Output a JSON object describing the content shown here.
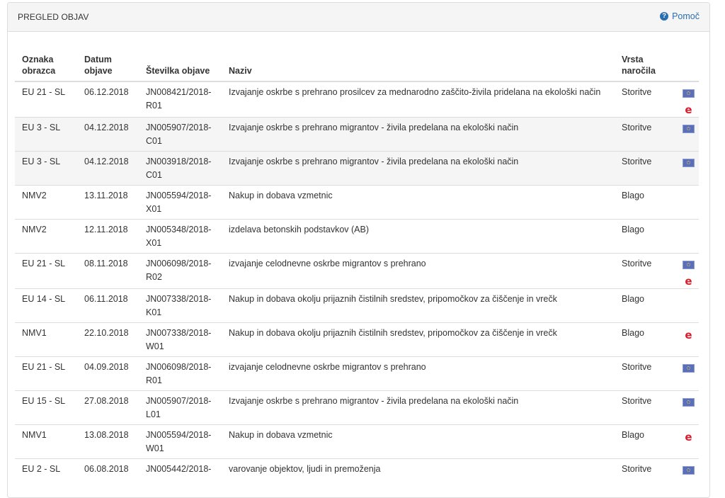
{
  "panel": {
    "title": "PREGLED OBJAV",
    "help_label": "Pomoč"
  },
  "table": {
    "headers": {
      "oznaka_1": "Oznaka",
      "oznaka_2": "obrazca",
      "datum_1": "Datum",
      "datum_2": "objave",
      "stevilka": "Številka objave",
      "naziv": "Naziv",
      "vrsta_1": "Vrsta",
      "vrsta_2": "naročila"
    },
    "rows": [
      {
        "oznaka": "EU 21 - SL",
        "datum": "06.12.2018",
        "stevilka_1": "JN008421/2018-",
        "stevilka_2": "R01",
        "naziv": "Izvajanje oskrbe s prehrano prosilcev za mednarodno zaščito-živila pridelana na ekološki način",
        "vrsta": "Storitve",
        "eu": true,
        "e": true
      },
      {
        "oznaka": "EU 3 - SL",
        "datum": "04.12.2018",
        "stevilka_1": "JN005907/2018-",
        "stevilka_2": "C01",
        "naziv": "Izvajanje oskrbe s prehrano migrantov - živila predelana na ekološki način",
        "vrsta": "Storitve",
        "eu": true,
        "e": false
      },
      {
        "oznaka": "EU 3 - SL",
        "datum": "04.12.2018",
        "stevilka_1": "JN003918/2018-",
        "stevilka_2": "C01",
        "naziv": "Izvajanje oskrbe s prehrano migrantov - živila predelana na ekološki način",
        "vrsta": "Storitve",
        "eu": true,
        "e": false
      },
      {
        "oznaka": "NMV2",
        "datum": "13.11.2018",
        "stevilka_1": "JN005594/2018-",
        "stevilka_2": "X01",
        "naziv": "Nakup in dobava vzmetnic",
        "vrsta": "Blago",
        "eu": false,
        "e": false
      },
      {
        "oznaka": "NMV2",
        "datum": "12.11.2018",
        "stevilka_1": "JN005348/2018-",
        "stevilka_2": "X01",
        "naziv": "izdelava betonskih podstavkov (AB)",
        "vrsta": "Blago",
        "eu": false,
        "e": false
      },
      {
        "oznaka": "EU 21 - SL",
        "datum": "08.11.2018",
        "stevilka_1": "JN006098/2018-",
        "stevilka_2": "R02",
        "naziv": "izvajanje celodnevne oskrbe migrantov s prehrano",
        "vrsta": "Storitve",
        "eu": true,
        "e": true
      },
      {
        "oznaka": "EU 14 - SL",
        "datum": "06.11.2018",
        "stevilka_1": "JN007338/2018-",
        "stevilka_2": "K01",
        "naziv": "Nakup in dobava okolju prijaznih čistilnih sredstev, pripomočkov za čiščenje in vrečk",
        "vrsta": "Blago",
        "eu": false,
        "e": false
      },
      {
        "oznaka": "NMV1",
        "datum": "22.10.2018",
        "stevilka_1": "JN007338/2018-",
        "stevilka_2": "W01",
        "naziv": "Nakup in dobava okolju prijaznih čistilnih sredstev, pripomočkov za čiščenje in vrečk",
        "vrsta": "Blago",
        "eu": false,
        "e": true
      },
      {
        "oznaka": "EU 21 - SL",
        "datum": "04.09.2018",
        "stevilka_1": "JN006098/2018-",
        "stevilka_2": "R01",
        "naziv": "izvajanje celodnevne oskrbe migrantov s prehrano",
        "vrsta": "Storitve",
        "eu": true,
        "e": false
      },
      {
        "oznaka": "EU 15 - SL",
        "datum": "27.08.2018",
        "stevilka_1": "JN005907/2018-",
        "stevilka_2": "L01",
        "naziv": "Izvajanje oskrbe s prehrano migrantov - živila predelana na ekološki način",
        "vrsta": "Storitve",
        "eu": true,
        "e": false
      },
      {
        "oznaka": "NMV1",
        "datum": "13.08.2018",
        "stevilka_1": "JN005594/2018-",
        "stevilka_2": "W01",
        "naziv": "Nakup in dobava vzmetnic",
        "vrsta": "Blago",
        "eu": false,
        "e": true
      },
      {
        "oznaka": "EU 2 - SL",
        "datum": "06.08.2018",
        "stevilka_1": "JN005442/2018-",
        "stevilka_2": "",
        "naziv": "varovanje objektov, ljudi in premoženja",
        "vrsta": "Storitve",
        "eu": true,
        "e": false
      }
    ]
  },
  "icons": {
    "eu_icon": "eu-flag-icon",
    "e_icon": "e-procurement-icon",
    "help_icon": "question-circle-icon",
    "e_color": "#d81e2c",
    "eu_color": "#5b6fb8",
    "link_color": "#2a6db0"
  }
}
